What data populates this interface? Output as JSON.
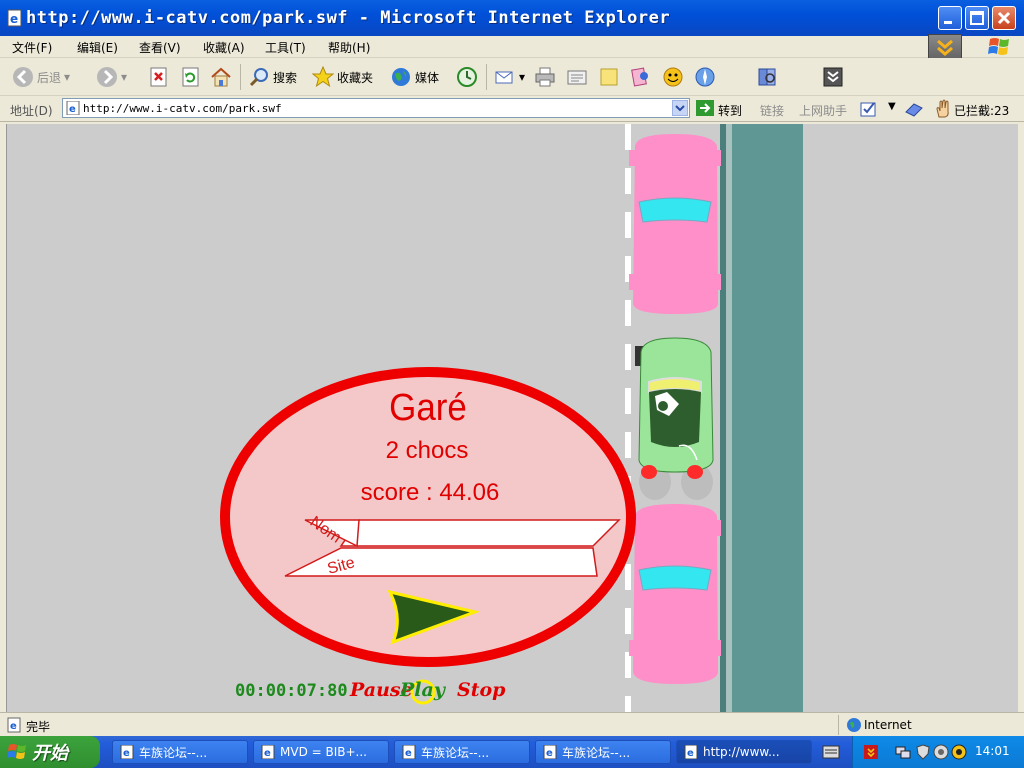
{
  "window": {
    "title": "http://www.i-catv.com/park.swf - Microsoft Internet Explorer"
  },
  "menu": {
    "items": [
      "文件(F)",
      "编辑(E)",
      "查看(V)",
      "收藏(A)",
      "工具(T)",
      "帮助(H)"
    ]
  },
  "toolbar": {
    "back_label": "后退",
    "search_label": "搜索",
    "favorites_label": "收藏夹",
    "media_label": "媒体"
  },
  "address": {
    "label": "地址(D)",
    "url": "http://www.i-catv.com/park.swf",
    "go_label": "转到",
    "links_label": "链接",
    "assistant_label": "上网助手",
    "blocked_label": "已拦截:23"
  },
  "game": {
    "result_title": "Garé",
    "hits_text": "2 chocs",
    "score_text": "score : 44.06",
    "name_label": "Nom",
    "site_label": "Site",
    "timer": "00:00:07:80",
    "pause_label": "Pause",
    "play_label": "Play",
    "stop_label": "Stop",
    "colors": {
      "asphalt": "#cccccc",
      "sidewalk": "#5f9794",
      "parked_car": "#ff8fc8",
      "windshield": "#33e6f0",
      "player_car": "#9be59b",
      "badge_fill": "#f4c8c8",
      "badge_ring": "#ee0000",
      "play_arrow": "#2a5a1a",
      "play_arrow_outline": "#ffee00"
    }
  },
  "status": {
    "text": "完毕",
    "zone": "Internet"
  },
  "taskbar": {
    "start_label": "开始",
    "tasks": [
      {
        "label": "车族论坛--..."
      },
      {
        "label": "MVD = BIB+..."
      },
      {
        "label": "车族论坛--..."
      },
      {
        "label": "车族论坛--..."
      },
      {
        "label": "http://www..."
      }
    ],
    "clock": "14:01"
  }
}
